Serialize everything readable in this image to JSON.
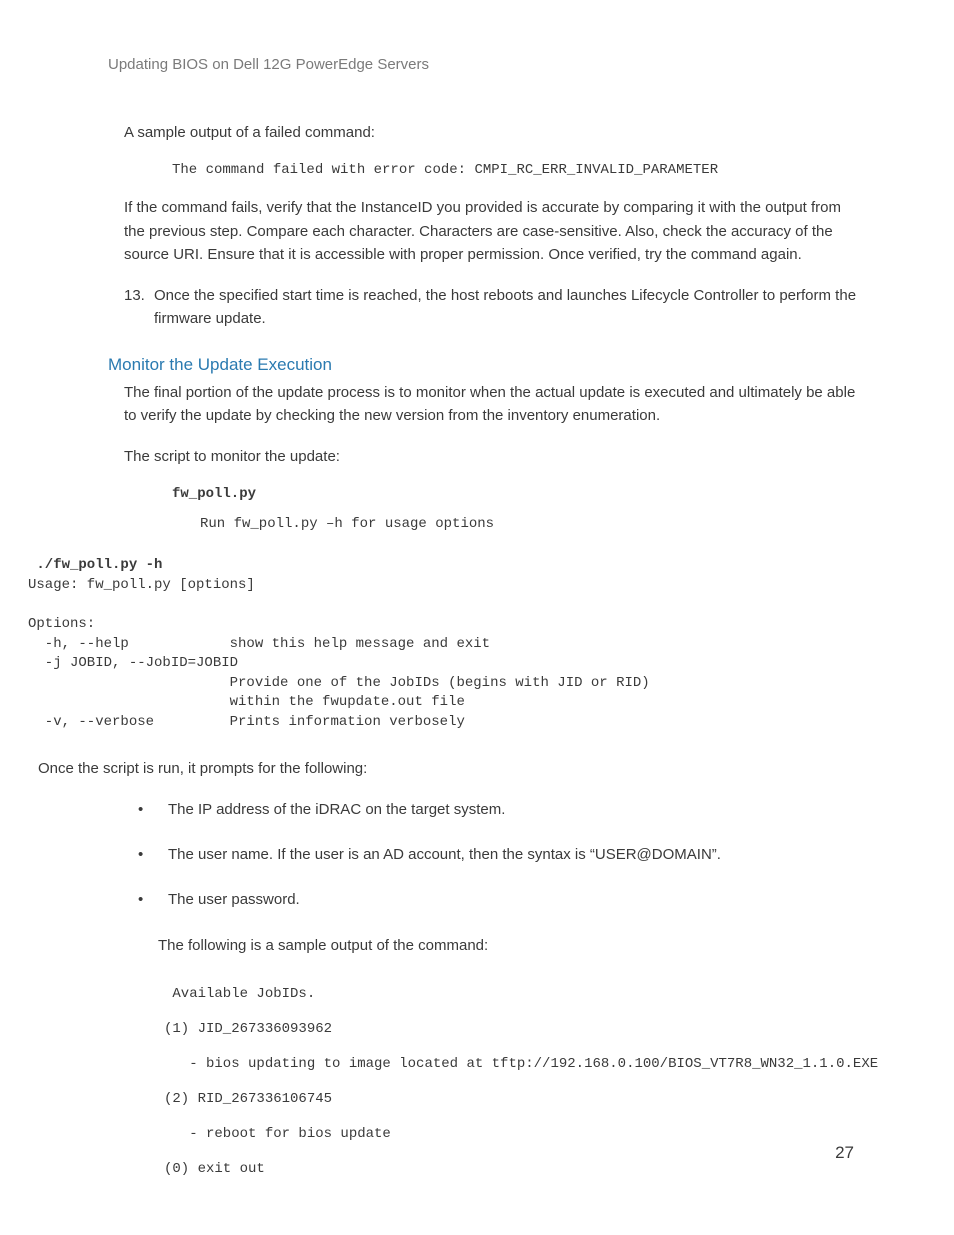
{
  "header": "Updating BIOS on Dell 12G PowerEdge Servers",
  "para_sample_failed": "A sample output of a failed command:",
  "code_failed": "The command failed with error code: CMPI_RC_ERR_INVALID_PARAMETER",
  "para_verify": "If the command fails, verify that the InstanceID you provided is accurate by comparing it with the output from the previous step.  Compare each character. Characters are case-sensitive. Also, check the accuracy of the source URI. Ensure that it is accessible with proper permission. Once verified, try the command again.",
  "step13_num": "13.",
  "step13_text": "Once the specified start time is reached, the host reboots and launches Lifecycle Controller to perform the firmware update.",
  "heading_monitor": "Monitor the Update Execution",
  "para_monitor_intro": "The final portion of the update process is to monitor when the actual update is executed and ultimately be able to verify the update by checking the new version from the inventory enumeration.",
  "para_script_intro": "The script to monitor the update:",
  "script_name": "fw_poll.py",
  "script_desc": "Run fw_poll.py –h for usage options",
  "help_cmd": " ./fw_poll.py -h",
  "help_usage": "Usage: fw_poll.py [options]",
  "help_options_label": "Options:",
  "help_h": "  -h, --help            show this help message and exit",
  "help_j": "  -j JOBID, --JobID=JOBID",
  "help_j2": "                        Provide one of the JobIDs (begins with JID or RID)",
  "help_j3": "                        within the fwupdate.out file",
  "help_v": "  -v, --verbose         Prints information verbosely",
  "para_once_run": "Once the script is run, it prompts for the following:",
  "bullets": [
    "The IP address of the iDRAC on the target system.",
    "The user name. If the user is an AD account, then the syntax is “USER@DOMAIN”.",
    " The user password."
  ],
  "para_following_sample": "The following is a sample output of the command:",
  "sample": {
    "l1": " Available JobIDs.",
    "l2": "(1) JID_267336093962",
    "l3": "   - bios updating to image located at tftp://192.168.0.100/BIOS_VT7R8_WN32_1.1.0.EXE",
    "l4": "(2) RID_267336106745",
    "l5": "   - reboot for bios update",
    "l6": "(0) exit out"
  },
  "page_number": "27"
}
